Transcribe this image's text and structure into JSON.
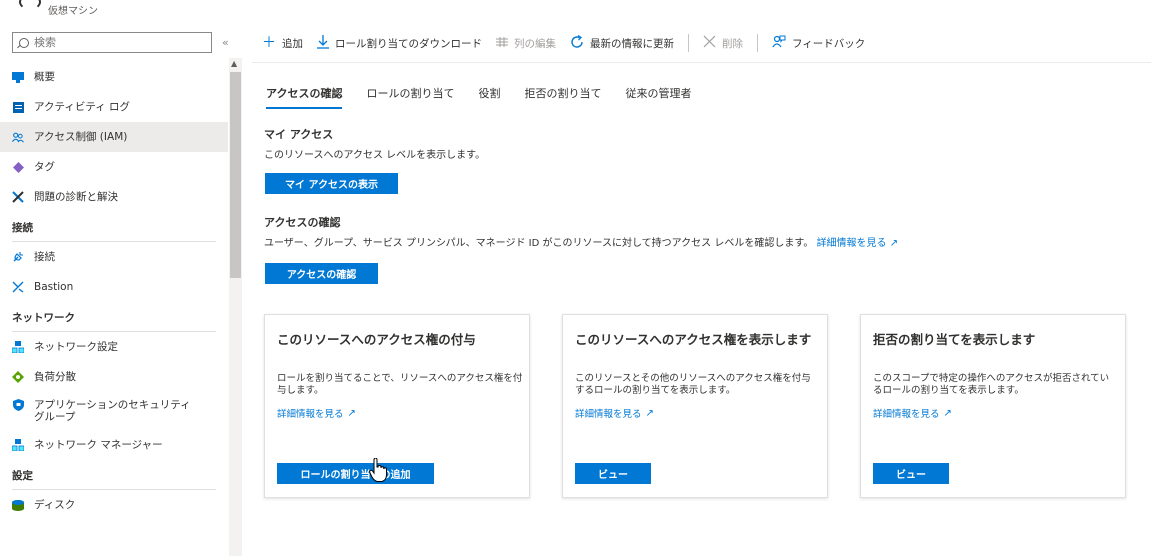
{
  "resource": {
    "subtitle": "仮想マシン"
  },
  "search": {
    "placeholder": "検索"
  },
  "collapse_glyph": "«",
  "sidebar": {
    "items_top": [
      {
        "label": "概要",
        "icon": "monitor-icon",
        "color": "#0078d4"
      },
      {
        "label": "アクティビティ ログ",
        "icon": "log-icon",
        "color": "#0063b1"
      },
      {
        "label": "アクセス制御 (IAM)",
        "icon": "people-icon",
        "color": "#0078d4",
        "active": true
      },
      {
        "label": "タグ",
        "icon": "tag-icon",
        "color": "#8661c5"
      },
      {
        "label": "問題の診断と解決",
        "icon": "tools-icon",
        "color": "#0078d4"
      }
    ],
    "section_connect": "接続",
    "items_connect": [
      {
        "label": "接続",
        "icon": "plug-icon",
        "color": "#0078d4"
      },
      {
        "label": "Bastion",
        "icon": "bastion-icon",
        "color": "#0078d4"
      }
    ],
    "section_network": "ネットワーク",
    "items_network": [
      {
        "label": "ネットワーク設定",
        "icon": "network-icon",
        "color": "#0078d4"
      },
      {
        "label": "負荷分散",
        "icon": "loadbalancer-icon",
        "color": "#57a300"
      },
      {
        "label": "アプリケーションのセキュリティ グループ",
        "icon": "shield-icon",
        "color": "#0078d4"
      },
      {
        "label": "ネットワーク マネージャー",
        "icon": "network-manager-icon",
        "color": "#0078d4"
      }
    ],
    "section_settings": "設定",
    "items_settings": [
      {
        "label": "ディスク",
        "icon": "disk-icon",
        "color": "#57a300"
      }
    ]
  },
  "toolbar": {
    "add": "追加",
    "download": "ロール割り当てのダウンロード",
    "edit_columns": "列の編集",
    "refresh": "最新の情報に更新",
    "delete": "削除",
    "feedback": "フィードバック"
  },
  "tabs": [
    "アクセスの確認",
    "ロールの割り当て",
    "役割",
    "拒否の割り当て",
    "従来の管理者"
  ],
  "my_access": {
    "title": "マイ アクセス",
    "desc": "このリソースへのアクセス レベルを表示します。",
    "button": "マイ アクセスの表示"
  },
  "check_access": {
    "title": "アクセスの確認",
    "desc": "ユーザー、グループ、サービス プリンシパル、マネージド ID がこのリソースに対して持つアクセス レベルを確認します。",
    "link": "詳細情報を見る",
    "button": "アクセスの確認"
  },
  "cards": [
    {
      "title": "このリソースへのアクセス権の付与",
      "desc": "ロールを割り当てることで、リソースへのアクセス権を付与します。",
      "link": "詳細情報を見る",
      "button": "ロールの割り当ての追加"
    },
    {
      "title": "このリソースへのアクセス権を表示します",
      "desc": "このリソースとその他のリソースへのアクセス権を付与するロールの割り当てを表示します。",
      "link": "詳細情報を見る",
      "button": "ビュー"
    },
    {
      "title": "拒否の割り当てを表示します",
      "desc": "このスコープで特定の操作へのアクセスが拒否されているロールの割り当てを表示します。",
      "link": "詳細情報を見る",
      "button": "ビュー"
    }
  ],
  "colors": {
    "accent": "#0078d4",
    "active_bg": "#edebe9",
    "text": "#323130"
  }
}
